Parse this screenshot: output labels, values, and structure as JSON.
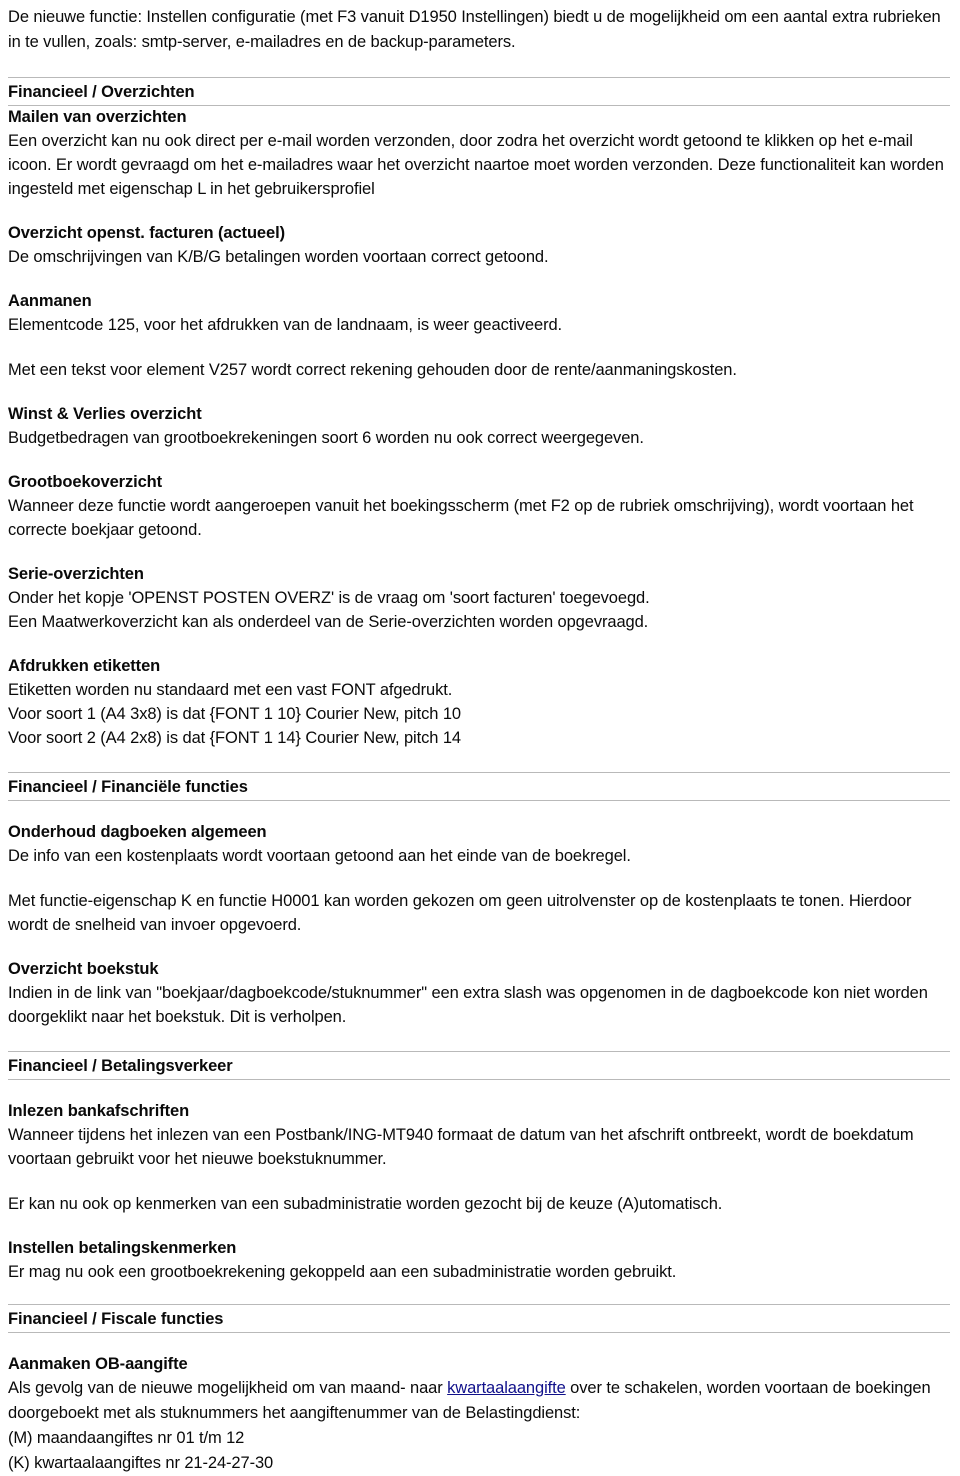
{
  "document": {
    "intro_paragraph": "De nieuwe functie: Instellen configuratie (met F3 vanuit D1950 Instellingen) biedt u de  mogelijkheid om een aantal extra rubrieken in te vullen, zoals: smtp-server, e-mailadres en de backup-parameters.",
    "link_color": "#10108a",
    "rule_color": "#b9b9b9",
    "text_color": "#0a0a0a",
    "background_color": "#ffffff"
  },
  "sections": [
    {
      "band_title": "Financieel / Overzichten",
      "blocks": [
        {
          "heading": "Mailen van overzichten",
          "paragraph": "Een overzicht kan nu ook direct per e-mail worden verzonden, door zodra het overzicht wordt getoond te klikken op het e-mail icoon. Er wordt gevraagd om het e-mailadres waar het overzicht naartoe moet worden verzonden. Deze functionaliteit kan worden ingesteld met eigenschap L in het gebruikersprofiel"
        },
        {
          "heading": "Overzicht openst. facturen (actueel)",
          "paragraph": "De omschrijvingen van K/B/G betalingen worden voortaan correct getoond."
        },
        {
          "heading": "Aanmanen",
          "paragraph": "Elementcode 125, voor het afdrukken van de landnaam, is weer geactiveerd."
        },
        {
          "heading": "",
          "paragraph": "Met een tekst voor element V257 wordt correct rekening gehouden door de rente/aanmaningskosten."
        },
        {
          "heading": "Winst & Verlies overzicht",
          "paragraph": "Budgetbedragen van grootboekrekeningen soort 6 worden nu ook correct weergegeven."
        },
        {
          "heading": "Grootboekoverzicht",
          "paragraph": "Wanneer deze functie wordt aangeroepen vanuit het boekingsscherm (met F2 op de rubriek omschrijving), wordt voortaan het correcte boekjaar getoond."
        },
        {
          "heading": "Serie-overzichten",
          "paragraph": "Onder het kopje 'OPENST POSTEN OVERZ' is de vraag om 'soort facturen' toegevoegd.\nEen Maatwerkoverzicht kan als onderdeel van de Serie-overzichten worden opgevraagd."
        },
        {
          "heading": "Afdrukken etiketten",
          "paragraph": "Etiketten worden nu standaard met een vast FONT afgedrukt.\nVoor soort 1 (A4 3x8) is dat {FONT 1 10} Courier New, pitch 10\nVoor soort 2 (A4 2x8) is dat {FONT 1 14} Courier New, pitch 14"
        }
      ]
    },
    {
      "band_title": "Financieel / Financiële functies",
      "blocks": [
        {
          "heading": "Onderhoud dagboeken algemeen",
          "paragraph": "De info van een kostenplaats wordt voortaan getoond aan het einde van de boekregel."
        },
        {
          "heading": "",
          "paragraph": "Met functie-eigenschap K en functie H0001 kan worden gekozen om geen uitrolvenster op de kostenplaats te tonen. Hierdoor wordt de snelheid van invoer opgevoerd."
        },
        {
          "heading": "Overzicht boekstuk",
          "paragraph": "Indien in de link van \"boekjaar/dagboekcode/stuknummer\" een extra slash was opgenomen in de dagboekcode kon niet worden doorgeklikt naar het boekstuk. Dit is verholpen."
        }
      ]
    },
    {
      "band_title": "Financieel / Betalingsverkeer",
      "blocks": [
        {
          "heading": "Inlezen bankafschriften",
          "paragraph": "Wanneer tijdens het inlezen van een Postbank/ING-MT940 formaat de datum van het afschrift ontbreekt, wordt de boekdatum voortaan gebruikt voor het nieuwe boekstuknummer."
        },
        {
          "heading": "",
          "paragraph": "Er kan nu ook op kenmerken van een subadministratie worden gezocht bij de keuze (A)utomatisch."
        },
        {
          "heading": "Instellen betalingskenmerken",
          "paragraph": "Er mag nu ook een grootboekrekening gekoppeld aan een subadministratie worden gebruikt."
        }
      ]
    },
    {
      "band_title": "Financieel / Fiscale functies",
      "blocks": [
        {
          "heading": "Aanmaken OB-aangifte",
          "paragraph_parts": {
            "before_link": "Als gevolg van de nieuwe mogelijkheid om van maand- naar ",
            "link_text": "kwartaalaangifte",
            "after_link": " over te schakelen, worden voortaan de boekingen doorgeboekt met als stuknummers het aangiftenummer van de Belastingdienst:"
          },
          "extra_lines": [
            "(M) maandaangiftes nr 01 t/m 12",
            "(K) kwartaalaangiftes nr 21-24-27-30"
          ]
        }
      ]
    }
  ]
}
